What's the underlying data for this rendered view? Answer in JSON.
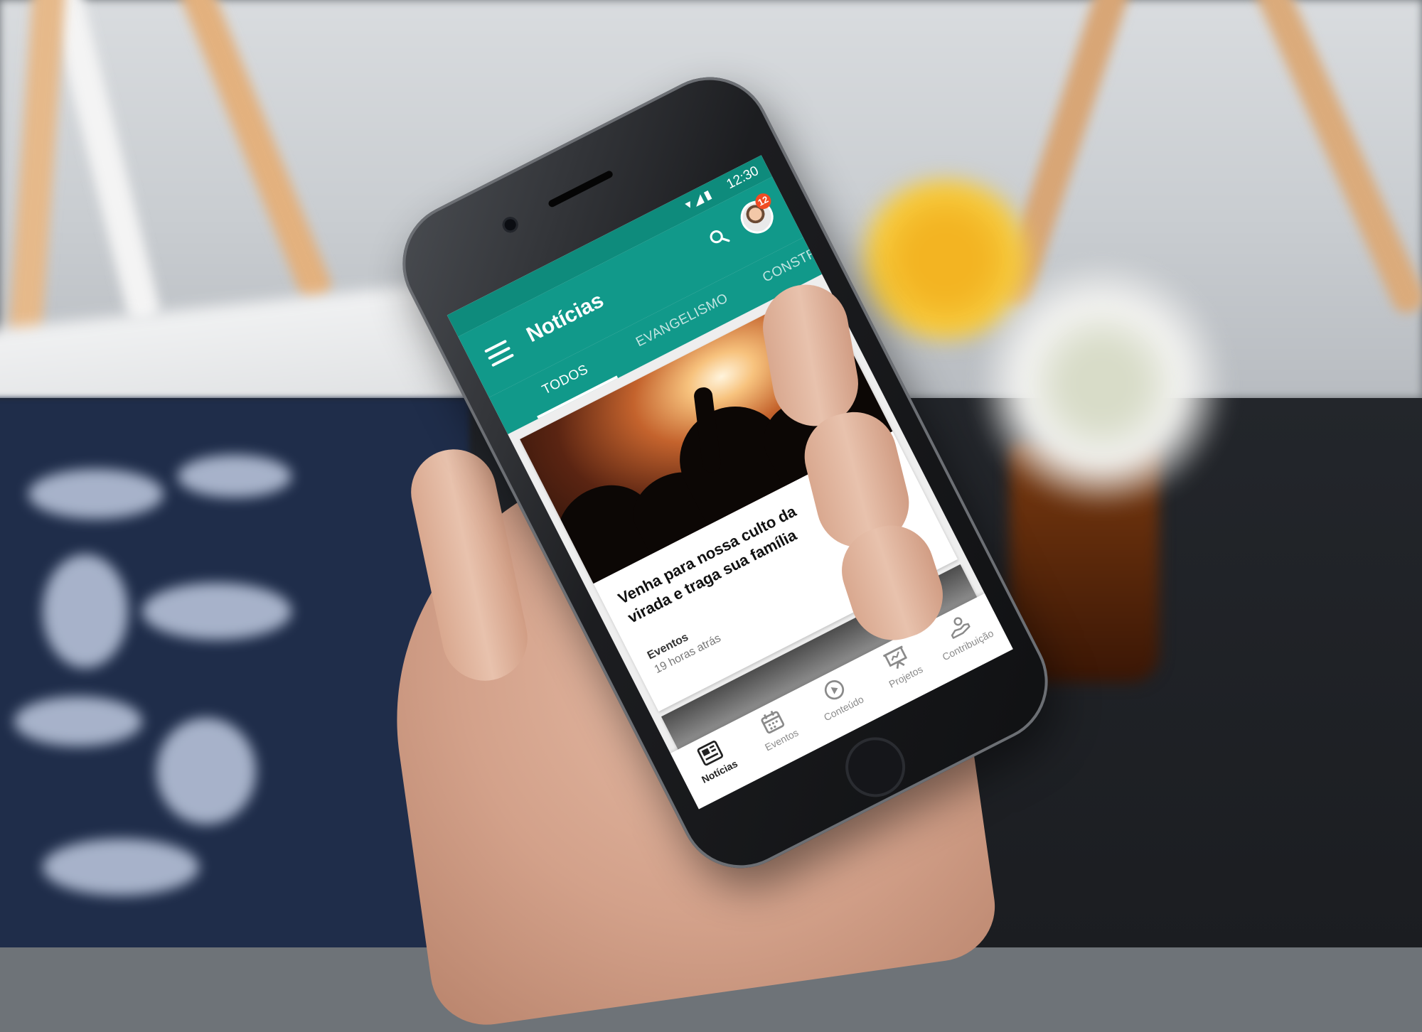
{
  "status_bar": {
    "time": "12:30",
    "icons": [
      "wifi-icon",
      "signal-icon",
      "battery-icon"
    ]
  },
  "app_bar": {
    "title": "Notícias",
    "notification_count": "12"
  },
  "tabs": [
    {
      "label": "TODOS",
      "active": true
    },
    {
      "label": "EVANGELISMO",
      "active": false
    },
    {
      "label": "CONSTR",
      "active": false
    }
  ],
  "feed": {
    "cards": [
      {
        "title": "Venha para nossa culto da virada e traga sua família",
        "category": "Eventos",
        "time": "19 horas atrás"
      }
    ]
  },
  "bottom_nav": [
    {
      "label": "Notícias",
      "icon": "newspaper-icon",
      "active": true
    },
    {
      "label": "Eventos",
      "icon": "calendar-icon",
      "active": false
    },
    {
      "label": "Conteúdo",
      "icon": "play-circle-icon",
      "active": false
    },
    {
      "label": "Projetos",
      "icon": "presentation-icon",
      "active": false
    },
    {
      "label": "Contribuição",
      "icon": "donate-hand-icon",
      "active": false
    }
  ],
  "colors": {
    "primary": "#11998a",
    "primary_dark": "#0e8b7c",
    "badge": "#f04b23"
  }
}
